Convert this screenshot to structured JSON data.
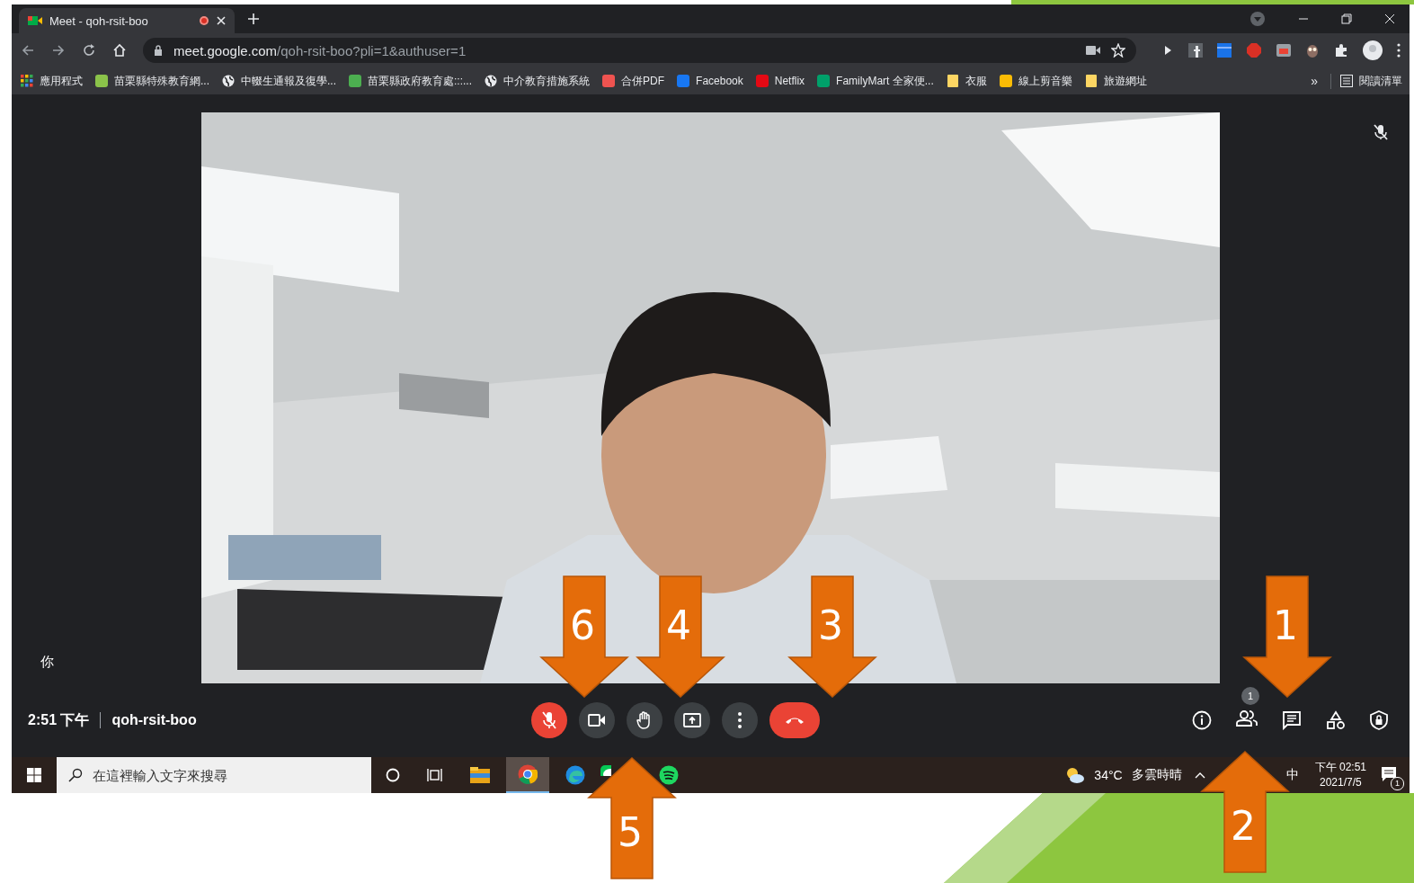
{
  "browser": {
    "tabs": [
      {
        "title": "Meet - qoh-rsit-boo",
        "selected": true,
        "recording": true
      }
    ],
    "address": {
      "host": "meet.google.com",
      "path": "/qoh-rsit-boo?pli=1&authuser=1"
    },
    "bookmarks": [
      {
        "label": "應用程式",
        "kind": "apps"
      },
      {
        "label": "苗栗縣特殊教育網...",
        "kind": "favicon",
        "color": "#8bc34a"
      },
      {
        "label": "中輟生通報及復學...",
        "kind": "globe"
      },
      {
        "label": "苗栗縣政府教育處:::...",
        "kind": "favicon",
        "color": "#4caf50"
      },
      {
        "label": "中介教育措施系統",
        "kind": "globe"
      },
      {
        "label": "合併PDF",
        "kind": "favicon",
        "color": "#ef5350"
      },
      {
        "label": "Facebook",
        "kind": "favicon",
        "color": "#1877f2"
      },
      {
        "label": "Netflix",
        "kind": "favicon",
        "color": "#e50914"
      },
      {
        "label": "FamilyMart 全家便...",
        "kind": "favicon",
        "color": "#00a06a"
      },
      {
        "label": "衣服",
        "kind": "folder"
      },
      {
        "label": "線上剪音樂",
        "kind": "favicon",
        "color": "#fbbc05"
      },
      {
        "label": "旅遊網址",
        "kind": "folder"
      }
    ],
    "overflow": "»",
    "reading_list": "閱讀清單"
  },
  "meeting": {
    "self_label": "你",
    "time": "2:51 下午",
    "code": "qoh-rsit-boo",
    "mic_muted": true,
    "participant_count": "1"
  },
  "taskbar": {
    "search_placeholder": "在這裡輸入文字來搜尋",
    "temperature": "34°C",
    "condition": "多雲時晴",
    "ime": "中",
    "time": "下午 02:51",
    "date": "2021/7/5",
    "notification_count": "1"
  },
  "callouts": [
    {
      "number": "6"
    },
    {
      "number": "4"
    },
    {
      "number": "3"
    },
    {
      "number": "1"
    },
    {
      "number": "5"
    },
    {
      "number": "2"
    }
  ]
}
